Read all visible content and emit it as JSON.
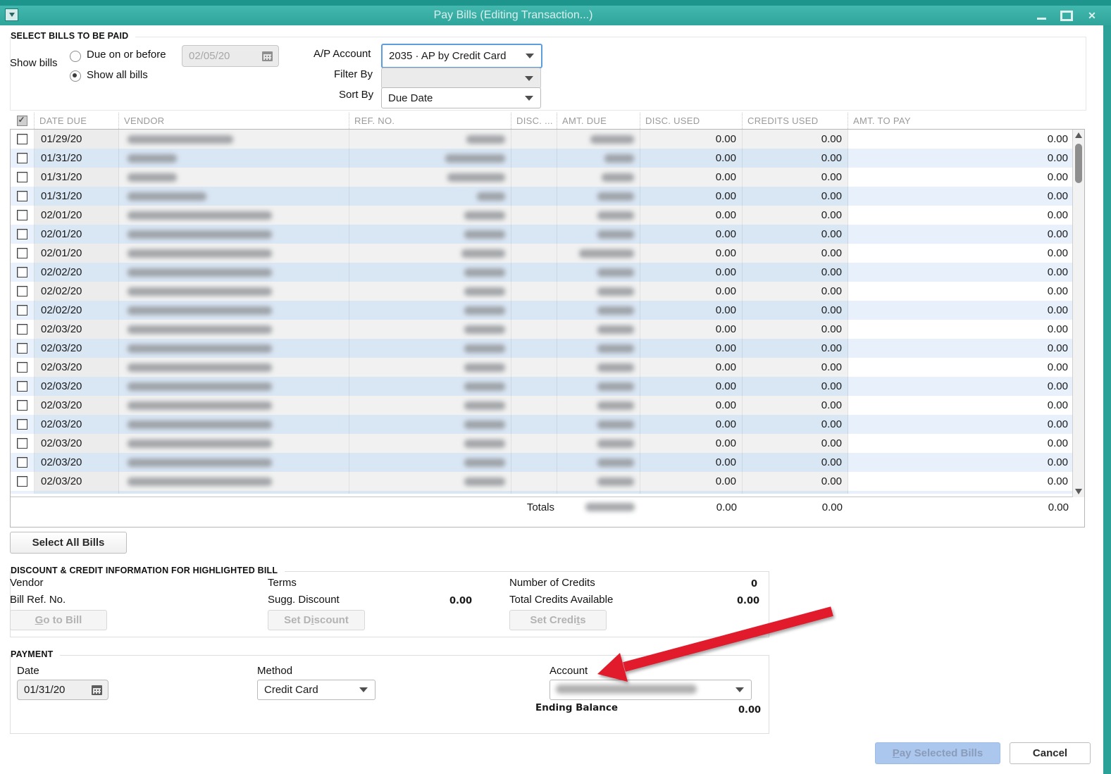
{
  "window": {
    "title": "Pay Bills (Editing Transaction...)"
  },
  "select_bills": {
    "section_title": "SELECT BILLS TO BE PAID",
    "show_bills_label": "Show bills",
    "radio_due_label": "Due on or before",
    "due_date_value": "02/05/20",
    "radio_all_label": "Show all bills",
    "ap_account_label": "A/P Account",
    "ap_account_value": "2035 · AP by Credit Card",
    "filter_by_label": "Filter By",
    "filter_by_value": "",
    "sort_by_label": "Sort By",
    "sort_by_value": "Due Date"
  },
  "table": {
    "headers": [
      "DATE DUE",
      "VENDOR",
      "REF. NO.",
      "DISC. ...",
      "AMT. DUE",
      "DISC. USED",
      "CREDITS USED",
      "AMT. TO PAY"
    ],
    "header_checkbox_checked": true,
    "rows": [
      {
        "date_due": "01/29/20",
        "vendor_redacted": true,
        "vendor_blur": 150,
        "ref_blur": 55,
        "amt_blur": 62,
        "disc_used": "0.00",
        "credits_used": "0.00",
        "amt_to_pay": "0.00"
      },
      {
        "date_due": "01/31/20",
        "vendor_redacted": true,
        "vendor_blur": 70,
        "ref_blur": 85,
        "amt_blur": 42,
        "disc_used": "0.00",
        "credits_used": "0.00",
        "amt_to_pay": "0.00"
      },
      {
        "date_due": "01/31/20",
        "vendor_redacted": true,
        "vendor_blur": 70,
        "ref_blur": 82,
        "amt_blur": 46,
        "disc_used": "0.00",
        "credits_used": "0.00",
        "amt_to_pay": "0.00"
      },
      {
        "date_due": "01/31/20",
        "vendor_redacted": true,
        "vendor_blur": 112,
        "ref_blur": 40,
        "amt_blur": 52,
        "disc_used": "0.00",
        "credits_used": "0.00",
        "amt_to_pay": "0.00"
      },
      {
        "date_due": "02/01/20",
        "vendor_redacted": true,
        "vendor_blur": 205,
        "ref_blur": 58,
        "amt_blur": 52,
        "disc_used": "0.00",
        "credits_used": "0.00",
        "amt_to_pay": "0.00"
      },
      {
        "date_due": "02/01/20",
        "vendor_redacted": true,
        "vendor_blur": 205,
        "ref_blur": 58,
        "amt_blur": 52,
        "disc_used": "0.00",
        "credits_used": "0.00",
        "amt_to_pay": "0.00"
      },
      {
        "date_due": "02/01/20",
        "vendor_redacted": true,
        "vendor_blur": 205,
        "ref_blur": 62,
        "amt_blur": 78,
        "disc_used": "0.00",
        "credits_used": "0.00",
        "amt_to_pay": "0.00"
      },
      {
        "date_due": "02/02/20",
        "vendor_redacted": true,
        "vendor_blur": 205,
        "ref_blur": 58,
        "amt_blur": 52,
        "disc_used": "0.00",
        "credits_used": "0.00",
        "amt_to_pay": "0.00"
      },
      {
        "date_due": "02/02/20",
        "vendor_redacted": true,
        "vendor_blur": 205,
        "ref_blur": 58,
        "amt_blur": 52,
        "disc_used": "0.00",
        "credits_used": "0.00",
        "amt_to_pay": "0.00"
      },
      {
        "date_due": "02/02/20",
        "vendor_redacted": true,
        "vendor_blur": 205,
        "ref_blur": 58,
        "amt_blur": 52,
        "disc_used": "0.00",
        "credits_used": "0.00",
        "amt_to_pay": "0.00"
      },
      {
        "date_due": "02/03/20",
        "vendor_redacted": true,
        "vendor_blur": 205,
        "ref_blur": 58,
        "amt_blur": 52,
        "disc_used": "0.00",
        "credits_used": "0.00",
        "amt_to_pay": "0.00"
      },
      {
        "date_due": "02/03/20",
        "vendor_redacted": true,
        "vendor_blur": 205,
        "ref_blur": 58,
        "amt_blur": 52,
        "disc_used": "0.00",
        "credits_used": "0.00",
        "amt_to_pay": "0.00"
      },
      {
        "date_due": "02/03/20",
        "vendor_redacted": true,
        "vendor_blur": 205,
        "ref_blur": 58,
        "amt_blur": 52,
        "disc_used": "0.00",
        "credits_used": "0.00",
        "amt_to_pay": "0.00"
      },
      {
        "date_due": "02/03/20",
        "vendor_redacted": true,
        "vendor_blur": 205,
        "ref_blur": 58,
        "amt_blur": 52,
        "disc_used": "0.00",
        "credits_used": "0.00",
        "amt_to_pay": "0.00"
      },
      {
        "date_due": "02/03/20",
        "vendor_redacted": true,
        "vendor_blur": 205,
        "ref_blur": 58,
        "amt_blur": 52,
        "disc_used": "0.00",
        "credits_used": "0.00",
        "amt_to_pay": "0.00"
      },
      {
        "date_due": "02/03/20",
        "vendor_redacted": true,
        "vendor_blur": 205,
        "ref_blur": 58,
        "amt_blur": 52,
        "disc_used": "0.00",
        "credits_used": "0.00",
        "amt_to_pay": "0.00"
      },
      {
        "date_due": "02/03/20",
        "vendor_redacted": true,
        "vendor_blur": 205,
        "ref_blur": 58,
        "amt_blur": 52,
        "disc_used": "0.00",
        "credits_used": "0.00",
        "amt_to_pay": "0.00"
      },
      {
        "date_due": "02/03/20",
        "vendor_redacted": true,
        "vendor_blur": 205,
        "ref_blur": 58,
        "amt_blur": 52,
        "disc_used": "0.00",
        "credits_used": "0.00",
        "amt_to_pay": "0.00"
      },
      {
        "date_due": "02/03/20",
        "vendor_redacted": true,
        "vendor_blur": 205,
        "ref_blur": 58,
        "amt_blur": 52,
        "disc_used": "0.00",
        "credits_used": "0.00",
        "amt_to_pay": "0.00"
      }
    ],
    "totals": {
      "label": "Totals",
      "amt_due_redacted": true,
      "amt_due_blur": 70,
      "disc_used": "0.00",
      "credits_used": "0.00",
      "amt_to_pay": "0.00"
    }
  },
  "select_all_button_label": "Select All Bills",
  "discount_section": {
    "title": "DISCOUNT & CREDIT INFORMATION FOR HIGHLIGHTED BILL",
    "vendor_label": "Vendor",
    "bill_ref_label": "Bill Ref. No.",
    "terms_label": "Terms",
    "sugg_discount_label": "Sugg. Discount",
    "sugg_discount_value": "0.00",
    "number_of_credits_label": "Number of Credits",
    "number_of_credits_value": "0",
    "total_credits_label": "Total Credits Available",
    "total_credits_value": "0.00",
    "go_to_bill": {
      "pre": "",
      "u": "G",
      "post": "o to Bill"
    },
    "set_discount": {
      "pre": "Set D",
      "u": "i",
      "post": "scount"
    },
    "set_credits": {
      "pre": "Set Credi",
      "u": "t",
      "post": "s"
    }
  },
  "payment": {
    "title": "PAYMENT",
    "date_label": "Date",
    "date_value": "01/31/20",
    "method_label": "Method",
    "method_value": "Credit Card",
    "account_label": "Account",
    "account_value_redacted": true,
    "ending_balance_label": "Ending Balance",
    "ending_balance_value": "0.00"
  },
  "footer": {
    "pay_button": {
      "pre": "",
      "u": "P",
      "post": "ay Selected Bills"
    },
    "cancel_button_label": "Cancel"
  },
  "colors": {
    "titlebar_teal": "#2ea49b",
    "row_blue": "#d9e6f4",
    "focus_border_blue": "#5e9ce0",
    "arrow_red": "#e21b2c",
    "primary_button_blue": "#abc7ed"
  }
}
